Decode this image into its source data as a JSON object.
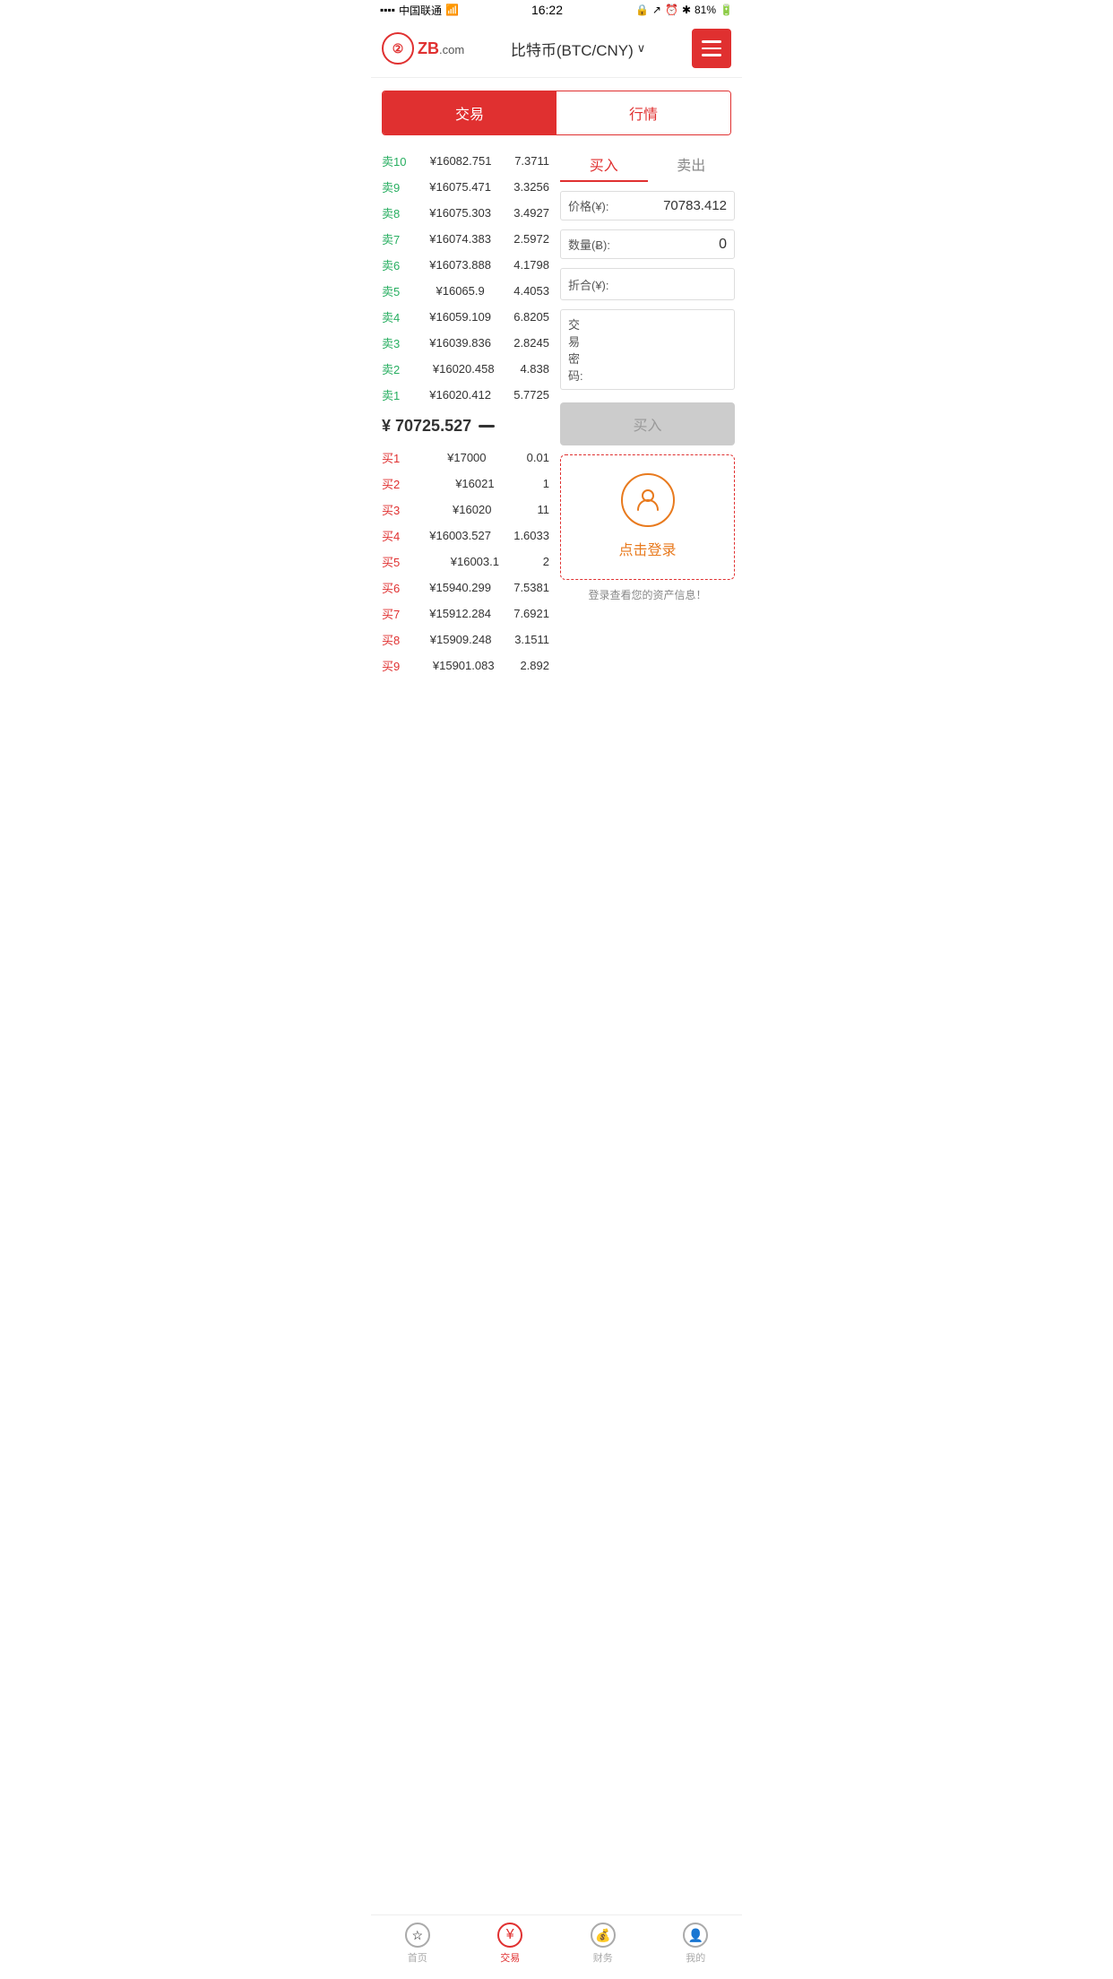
{
  "statusBar": {
    "carrier": "中国联通",
    "time": "16:22",
    "battery": "81%"
  },
  "header": {
    "logoText": "ZB",
    "logoDomain": ".com",
    "title": "比特币(BTC/CNY)",
    "menuAriaLabel": "菜单"
  },
  "tabs": {
    "trade": "交易",
    "market": "行情"
  },
  "orderBook": {
    "sellOrders": [
      {
        "label": "卖10",
        "price": "¥16082.751",
        "qty": "7.3711"
      },
      {
        "label": "卖9",
        "price": "¥16075.471",
        "qty": "3.3256"
      },
      {
        "label": "卖8",
        "price": "¥16075.303",
        "qty": "3.4927"
      },
      {
        "label": "卖7",
        "price": "¥16074.383",
        "qty": "2.5972"
      },
      {
        "label": "卖6",
        "price": "¥16073.888",
        "qty": "4.1798"
      },
      {
        "label": "卖5",
        "price": "¥16065.9",
        "qty": "4.4053"
      },
      {
        "label": "卖4",
        "price": "¥16059.109",
        "qty": "6.8205"
      },
      {
        "label": "卖3",
        "price": "¥16039.836",
        "qty": "2.8245"
      },
      {
        "label": "卖2",
        "price": "¥16020.458",
        "qty": "4.838"
      },
      {
        "label": "卖1",
        "price": "¥16020.412",
        "qty": "5.7725"
      }
    ],
    "currentPrice": "¥ 70725.527",
    "buyOrders": [
      {
        "label": "买1",
        "price": "¥17000",
        "qty": "0.01"
      },
      {
        "label": "买2",
        "price": "¥16021",
        "qty": "1"
      },
      {
        "label": "买3",
        "price": "¥16020",
        "qty": "11"
      },
      {
        "label": "买4",
        "price": "¥16003.527",
        "qty": "1.6033"
      },
      {
        "label": "买5",
        "price": "¥16003.1",
        "qty": "2"
      },
      {
        "label": "买6",
        "price": "¥15940.299",
        "qty": "7.5381"
      },
      {
        "label": "买7",
        "price": "¥15912.284",
        "qty": "7.6921"
      },
      {
        "label": "买8",
        "price": "¥15909.248",
        "qty": "3.1511"
      },
      {
        "label": "买9",
        "price": "¥15901.083",
        "qty": "2.892"
      }
    ]
  },
  "tradePanel": {
    "buyTab": "买入",
    "sellTab": "卖出",
    "priceLabel": "价格(¥):",
    "priceValue": "70783.412",
    "qtyLabel": "数量(Ƀ):",
    "qtyValue": "0",
    "totalLabel": "折合(¥):",
    "totalValue": "",
    "pwdLabel": "交易密码:",
    "pwdValue": "",
    "buyButton": "买入"
  },
  "loginBox": {
    "loginText": "点击登录",
    "assetInfo": "登录查看您的资产信息！"
  },
  "bottomNav": {
    "home": "首页",
    "trade": "交易",
    "finance": "财务",
    "profile": "我的"
  }
}
